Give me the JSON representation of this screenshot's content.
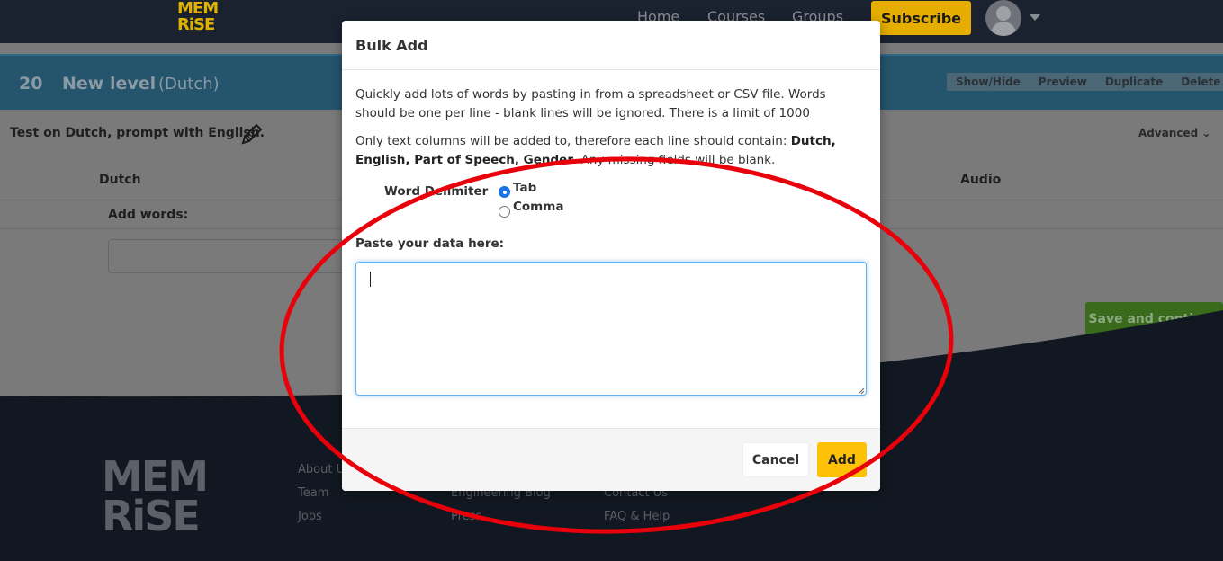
{
  "topbar": {
    "logo_line1": "MEM",
    "logo_line2": "RiSE",
    "nav": [
      "Home",
      "Courses",
      "Groups"
    ],
    "subscribe_label": "Subscribe"
  },
  "level": {
    "number": "20",
    "name": "New level",
    "language": "(Dutch)",
    "buttons": [
      "Show/Hide",
      "Preview",
      "Duplicate",
      "Delete"
    ]
  },
  "editor": {
    "test_on": "Test on Dutch, prompt with English.",
    "advanced_label": "Advanced",
    "columns": [
      "Dutch",
      "Audio"
    ],
    "add_words_label": "Add words:",
    "save_continue_label": "Save and continue"
  },
  "footer": {
    "logo_line1": "MEM",
    "logo_line2": "RiSE",
    "col1": [
      "About U",
      "Team",
      "Jobs"
    ],
    "col2": [
      "Engineering Blog",
      "Press"
    ],
    "col3": [
      "Contact Us",
      "FAQ & Help"
    ]
  },
  "modal": {
    "title": "Bulk Add",
    "description1": "Quickly add lots of words by pasting in from a spreadsheet or CSV file. Words should be one per line - blank lines will be ignored. There is a limit of 1000",
    "description2_prefix": "Only text columns will be added to, therefore each line should contain: ",
    "description2_fields": "Dutch, English, Part of Speech, Gender",
    "description2_suffix": ". Any missing fields will be blank.",
    "delimiter_label": "Word Delimiter",
    "delimiter_options": [
      {
        "label": "Tab",
        "checked": true
      },
      {
        "label": "Comma",
        "checked": false
      }
    ],
    "paste_label": "Paste your data here:",
    "paste_value": "",
    "cancel_label": "Cancel",
    "add_label": "Add"
  },
  "colors": {
    "accent_yellow": "#ffc107",
    "focus_blue": "#66afe9",
    "annotation_red": "#e8000b",
    "save_green": "#5cb21e"
  }
}
